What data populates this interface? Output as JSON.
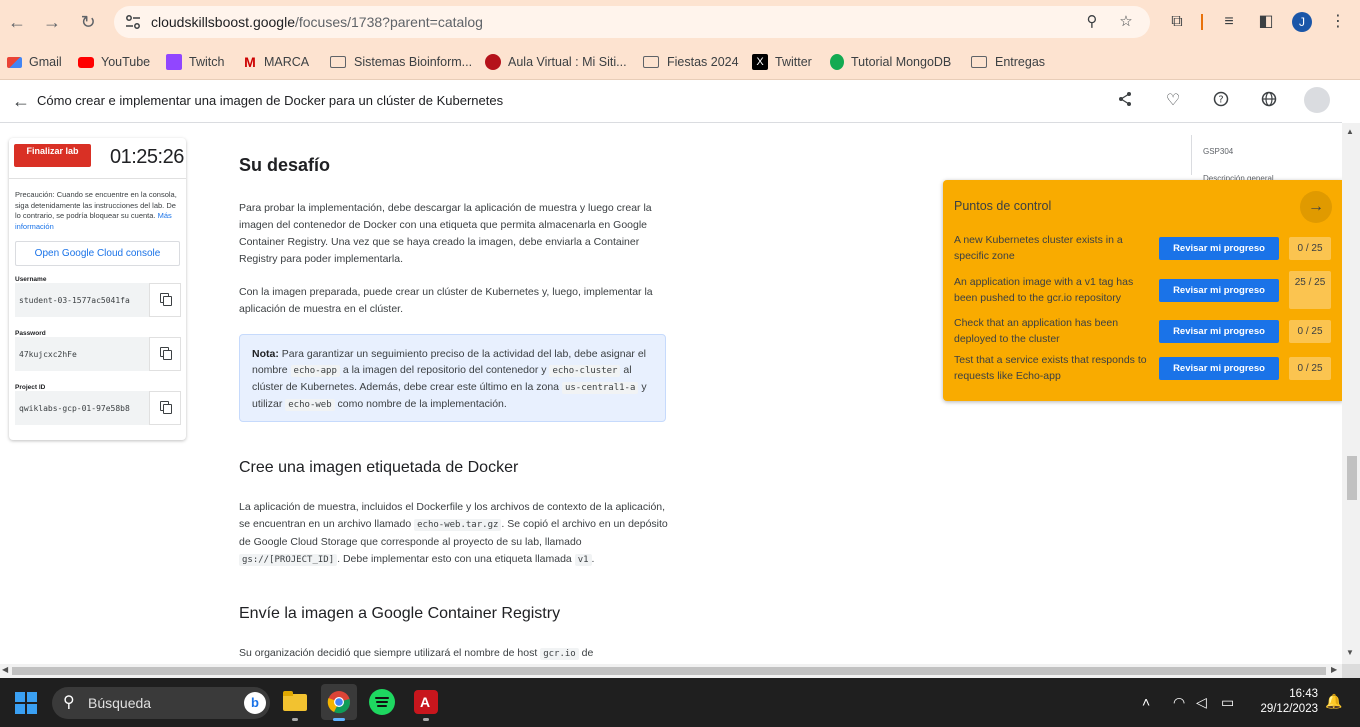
{
  "browser": {
    "url_host": "cloudskillsboost.google",
    "url_path": "/focuses/1738?parent=catalog",
    "profile_initial": "J"
  },
  "bookmarks": [
    {
      "label": "Gmail",
      "icon": "gmail-icon"
    },
    {
      "label": "YouTube",
      "icon": "youtube-icon"
    },
    {
      "label": "Twitch",
      "icon": "twitch-icon"
    },
    {
      "label": "MARCA",
      "icon": "marca-icon"
    },
    {
      "label": "Sistemas Bioinform...",
      "icon": "folder-icon"
    },
    {
      "label": "Aula Virtual : Mi Siti...",
      "icon": "um-icon"
    },
    {
      "label": "Fiestas 2024",
      "icon": "folder-icon"
    },
    {
      "label": "Twitter",
      "icon": "x-icon"
    },
    {
      "label": "Tutorial MongoDB",
      "icon": "mongodb-icon"
    },
    {
      "label": "Entregas",
      "icon": "folder-icon"
    }
  ],
  "page": {
    "title": "Cómo crear e implementar una imagen de Docker para un clúster de Kubernetes"
  },
  "lab": {
    "end_button": "Finalizar lab",
    "timer": "01:25:26",
    "caution_label": "Precaución:",
    "caution_text": "Cuando se encuentre en la consola, siga detenidamente las instrucciones del lab. De lo contrario, se podría bloquear su cuenta.",
    "caution_link": "Más información",
    "console_button": "Open Google Cloud console",
    "username_label": "Username",
    "username_value": "student-03-1577ac5041fa",
    "password_label": "Password",
    "password_value": "47kujcxc2hFe",
    "project_label": "Project ID",
    "project_value": "qwiklabs-gcp-01-97e58b8"
  },
  "content": {
    "h_challenge": "Su desafío",
    "p1": "Para probar la implementación, debe descargar la aplicación de muestra y luego crear la imagen del contenedor de Docker con una etiqueta que permita almacenarla en Google Container Registry. Una vez que se haya creado la imagen, debe enviarla a Container Registry para poder implementarla.",
    "p2": "Con la imagen preparada, puede crear un clúster de Kubernetes y, luego, implementar la aplicación de muestra en el clúster.",
    "note_label": "Nota:",
    "note_t1": "Para garantizar un seguimiento preciso de la actividad del lab, debe asignar el nombre",
    "note_c1": "echo-app",
    "note_t2": "a la imagen del repositorio del contenedor y",
    "note_c2": "echo-cluster",
    "note_t3": "al clúster de Kubernetes. Además, debe crear este último en la zona",
    "note_c3": "us-central1-a",
    "note_t4": "y utilizar",
    "note_c4": "echo-web",
    "note_t5": "como nombre de la implementación.",
    "h_tag": "Cree una imagen etiquetada de Docker",
    "p3_t1": "La aplicación de muestra, incluidos el Dockerfile y los archivos de contexto de la aplicación, se encuentran en un archivo llamado",
    "p3_c1": "echo-web.tar.gz",
    "p3_t2": ". Se copió el archivo en un depósito de Google Cloud Storage que corresponde al proyecto de su lab, llamado",
    "p3_c2": "gs://[PROJECT_ID]",
    "p3_t3": ". Debe implementar esto con una etiqueta llamada",
    "p3_c3": "v1",
    "p3_t4": ".",
    "h_push": "Envíe la imagen a Google Container Registry",
    "p4_t1": "Su organización decidió que siempre utilizará el nombre de host",
    "p4_c1": "gcr.io",
    "p4_t2": "de"
  },
  "toc": {
    "code": "GSP304",
    "item1": "Descripción general"
  },
  "checkpoints": {
    "title": "Puntos de control",
    "items": [
      {
        "text": "A new Kubernetes cluster exists in a specific zone",
        "button": "Revisar mi progreso",
        "score": "0 / 25"
      },
      {
        "text": "An application image with a v1 tag has been pushed to the gcr.io repository",
        "button": "Revisar mi progreso",
        "score": "25 / 25"
      },
      {
        "text": "Check that an application has been deployed to the cluster",
        "button": "Revisar mi progreso",
        "score": "0 / 25"
      },
      {
        "text": "Test that a service exists that responds to requests like Echo-app",
        "button": "Revisar mi progreso",
        "score": "0 / 25"
      }
    ]
  },
  "taskbar": {
    "search_placeholder": "Búsqueda",
    "time": "16:43",
    "date": "29/12/2023"
  },
  "colors": {
    "chrome_bg": "#fde3d0",
    "checkpoint_bg": "#f9ab00",
    "primary_blue": "#1a73e8",
    "end_red": "#d93025"
  }
}
